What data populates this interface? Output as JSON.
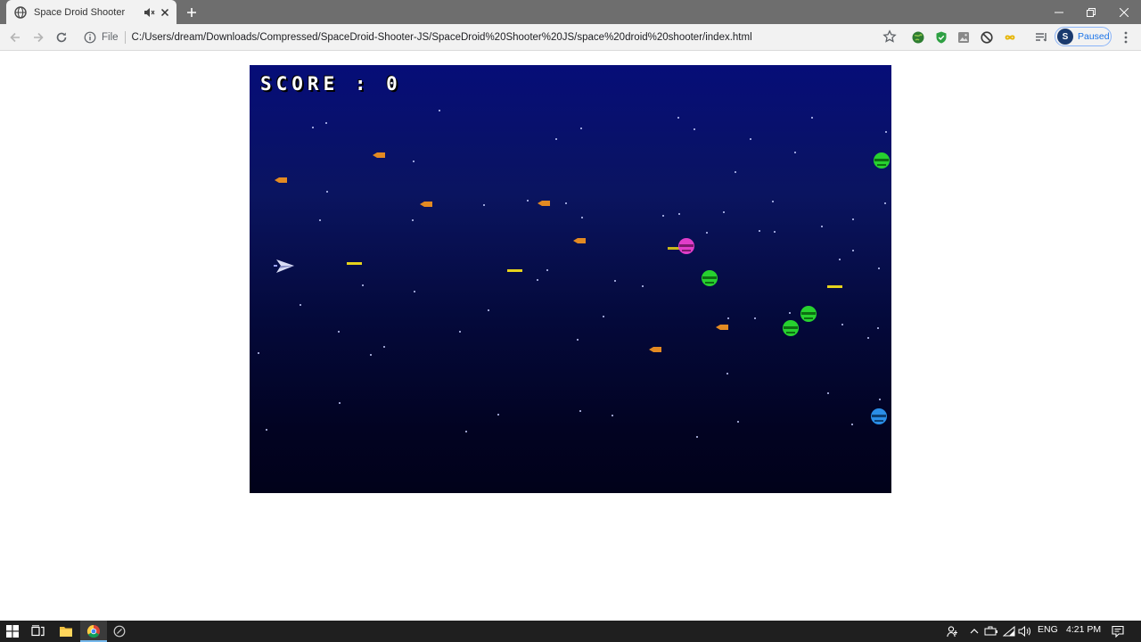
{
  "browser": {
    "tab_title": "Space Droid Shooter",
    "address_label": "File",
    "url": "C:/Users/dream/Downloads/Compressed/SpaceDroid-Shooter-JS/SpaceDroid%20Shooter%20JS/space%20droid%20shooter/index.html",
    "profile_status": "Paused"
  },
  "game": {
    "score_text": "SCORE : 0",
    "sprites": [
      "player-ship",
      "player-bullet",
      "enemy-missile",
      "green-droid",
      "pink-droid",
      "blue-droid"
    ]
  },
  "taskbar": {
    "language": "ENG",
    "time": "4:21 PM"
  },
  "colors": {
    "tabstrip": "#6e6e6e",
    "toolbar": "#f2f2f2",
    "game_top": "#060d78",
    "game_bottom": "#01021a",
    "green_droid": "#27d12f",
    "pink_droid": "#e03dc9",
    "blue_droid": "#2a8ee8",
    "missile": "#e38a22",
    "bullet": "#e6d31c",
    "taskbar": "#1f1f1f"
  }
}
